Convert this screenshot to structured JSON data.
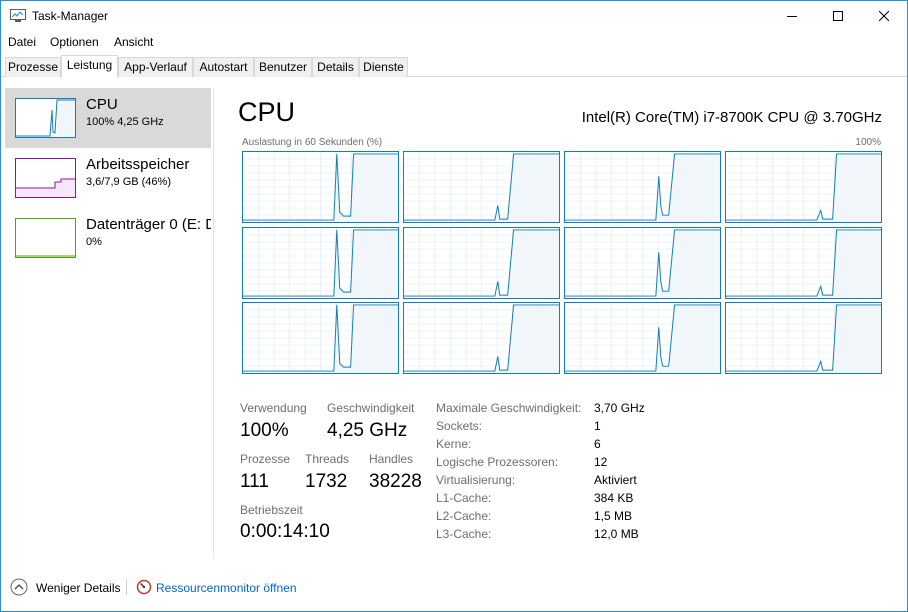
{
  "window": {
    "title": "Task-Manager",
    "accent": "#2b8fd6"
  },
  "menu": {
    "items": [
      "Datei",
      "Optionen",
      "Ansicht"
    ]
  },
  "tabs": [
    {
      "label": "Prozesse",
      "active": false
    },
    {
      "label": "Leistung",
      "active": true
    },
    {
      "label": "App-Verlauf",
      "active": false
    },
    {
      "label": "Autostart",
      "active": false
    },
    {
      "label": "Benutzer",
      "active": false
    },
    {
      "label": "Details",
      "active": false
    },
    {
      "label": "Dienste",
      "active": false
    }
  ],
  "sidebar": {
    "items": [
      {
        "name": "CPU",
        "sub": "100%  4,25 GHz",
        "color": "#117dbb",
        "selected": true
      },
      {
        "name": "Arbeitsspeicher",
        "sub": "3,6/7,9 GB (46%)",
        "color": "#8b12ae",
        "selected": false
      },
      {
        "name": "Datenträger 0 (E: D",
        "sub": "0%",
        "color": "#4da60c",
        "selected": false
      }
    ]
  },
  "main": {
    "title": "CPU",
    "model": "Intel(R) Core(TM) i7-8700K CPU @ 3.70GHz",
    "graph_label": "Auslastung in 60 Sekunden (%)",
    "graph_max": "100%",
    "graph_color": "#117dbb",
    "core_count": 12
  },
  "stats": {
    "usage_label": "Verwendung",
    "usage_value": "100%",
    "speed_label": "Geschwindigkeit",
    "speed_value": "4,25 GHz",
    "processes_label": "Prozesse",
    "processes_value": "111",
    "threads_label": "Threads",
    "threads_value": "1732",
    "handles_label": "Handles",
    "handles_value": "38228",
    "uptime_label": "Betriebszeit",
    "uptime_value": "0:00:14:10"
  },
  "specs": [
    {
      "label": "Maximale Geschwindigkeit:",
      "value": "3,70 GHz"
    },
    {
      "label": "Sockets:",
      "value": "1"
    },
    {
      "label": "Kerne:",
      "value": "6"
    },
    {
      "label": "Logische Prozessoren:",
      "value": "12"
    },
    {
      "label": "Virtualisierung:",
      "value": "Aktiviert"
    },
    {
      "label": "L1-Cache:",
      "value": "384 KB"
    },
    {
      "label": "L2-Cache:",
      "value": "1,5 MB"
    },
    {
      "label": "L3-Cache:",
      "value": "12,0 MB"
    }
  ],
  "bottom": {
    "less_details": "Weniger Details",
    "resource_monitor": "Ressourcenmonitor öffnen"
  }
}
